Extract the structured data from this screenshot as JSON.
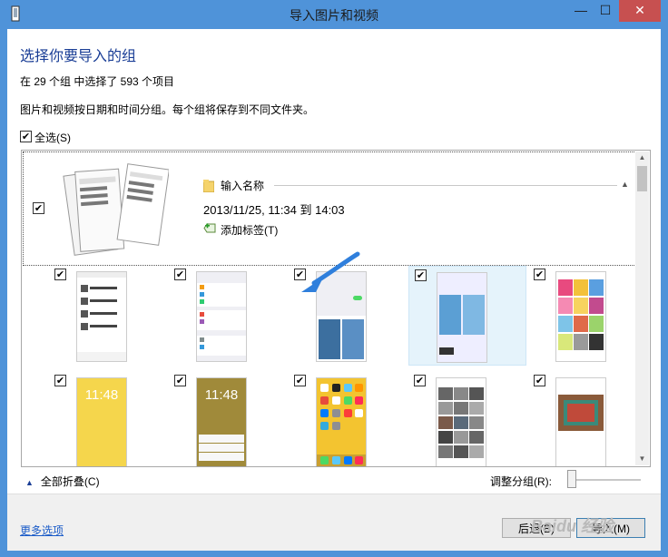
{
  "window": {
    "title": "导入图片和视频",
    "minimize": "—",
    "maximize": "☐",
    "close": "✕"
  },
  "heading": "选择你要导入的组",
  "summary": "在 29 个组 中选择了 593 个项目",
  "description": "图片和视频按日期和时间分组。每个组将保存到不同文件夹。",
  "select_all": {
    "label": "全选(S)",
    "checked": true
  },
  "group": {
    "checked": true,
    "name": "输入名称",
    "date": "2013/11/25, 11:34 到 14:03",
    "add_tag": "添加标签(T)"
  },
  "thumbnails": [
    {
      "checked": true,
      "style": "list"
    },
    {
      "checked": true,
      "style": "settings"
    },
    {
      "checked": true,
      "style": "lock-wallpaper"
    },
    {
      "checked": true,
      "style": "wallpaper-blue",
      "selected": true
    },
    {
      "checked": true,
      "style": "color-grid"
    },
    {
      "checked": true,
      "style": "yellow-lock",
      "time": "11:48"
    },
    {
      "checked": true,
      "style": "olive-lock",
      "time": "11:48"
    },
    {
      "checked": true,
      "style": "home-screen"
    },
    {
      "checked": true,
      "style": "photo-grid"
    },
    {
      "checked": true,
      "style": "photo"
    }
  ],
  "collapse_all": "全部折叠(C)",
  "adjust_groups": "调整分组(R):",
  "more_options": "更多选项",
  "buttons": {
    "back": "后退(B)",
    "import": "导入(M)"
  },
  "watermark": "Baidu 经验",
  "colors": {
    "accent_blue": "#4f93d9",
    "heading": "#1a3e96",
    "link": "#1a5bc8",
    "close": "#c75050",
    "arrow": "#2f7fdc"
  }
}
